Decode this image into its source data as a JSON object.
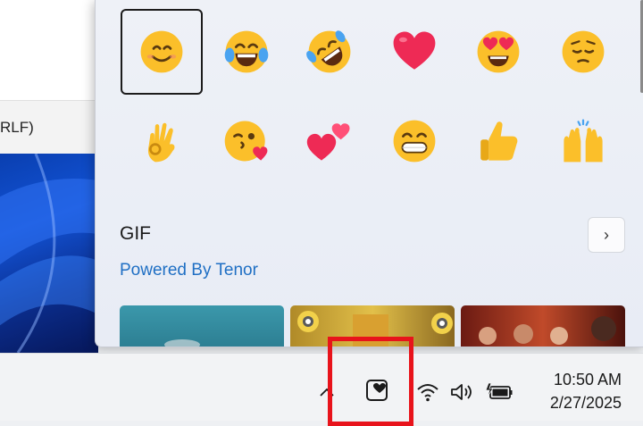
{
  "background": {
    "notepad_status_text": "RLF)"
  },
  "emoji_panel": {
    "emojis": [
      {
        "name": "smiling-face",
        "icon": "slightly-smiling-face"
      },
      {
        "name": "tears-of-joy",
        "icon": "face-with-tears-of-joy"
      },
      {
        "name": "rofl",
        "icon": "rolling-on-the-floor-laughing"
      },
      {
        "name": "red-heart",
        "icon": "red-heart"
      },
      {
        "name": "heart-eyes",
        "icon": "smiling-face-with-heart-eyes"
      },
      {
        "name": "pensive",
        "icon": "pensive-face"
      },
      {
        "name": "ok-hand",
        "icon": "ok-hand"
      },
      {
        "name": "kissing-wink",
        "icon": "face-blowing-a-kiss"
      },
      {
        "name": "two-hearts",
        "icon": "two-hearts"
      },
      {
        "name": "grinning",
        "icon": "beaming-face"
      },
      {
        "name": "thumbs-up",
        "icon": "thumbs-up"
      },
      {
        "name": "raising-hands",
        "icon": "raising-hands"
      }
    ],
    "selected_index": 0,
    "gif_section": {
      "title": "GIF",
      "powered_by": "Powered By Tenor",
      "next_icon": "chevron-right-icon"
    }
  },
  "taskbar": {
    "tray_icons": [
      "chevron-up-icon",
      "emoji-heart-icon",
      "wifi-icon",
      "volume-icon",
      "battery-charging-icon"
    ],
    "time": "10:50 AM",
    "date": "2/27/2025"
  },
  "colors": {
    "highlight": "#e8131b",
    "link": "#1f6fc4",
    "emoji_yellow": "#fbbf2a"
  }
}
